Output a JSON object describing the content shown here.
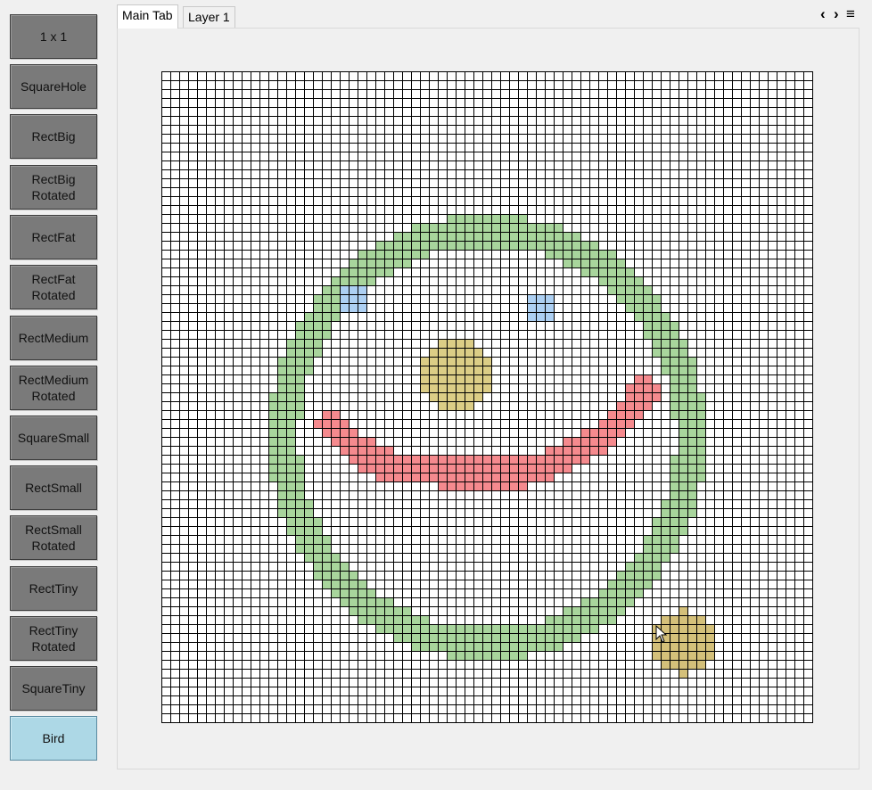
{
  "sidebar": {
    "buttons": [
      {
        "label": "1 x 1",
        "selected": false
      },
      {
        "label": "SquareHole",
        "selected": false
      },
      {
        "label": "RectBig",
        "selected": false
      },
      {
        "label": "RectBig\nRotated",
        "selected": false
      },
      {
        "label": "RectFat",
        "selected": false
      },
      {
        "label": "RectFat\nRotated",
        "selected": false
      },
      {
        "label": "RectMedium",
        "selected": false
      },
      {
        "label": "RectMedium\nRotated",
        "selected": false
      },
      {
        "label": "SquareSmall",
        "selected": false
      },
      {
        "label": "RectSmall",
        "selected": false
      },
      {
        "label": "RectSmall\nRotated",
        "selected": false
      },
      {
        "label": "RectTiny",
        "selected": false
      },
      {
        "label": "RectTiny\nRotated",
        "selected": false
      },
      {
        "label": "SquareTiny",
        "selected": false
      },
      {
        "label": "Bird",
        "selected": true
      }
    ]
  },
  "tabs": [
    {
      "label": "Main Tab",
      "active": true
    },
    {
      "label": "Layer 1",
      "active": false
    }
  ],
  "tab_nav": {
    "prev": "‹",
    "next": "›",
    "menu": "≡"
  },
  "canvas": {
    "columns": 73,
    "rows": 73,
    "background": "#ffffff",
    "grid_line_color": "#000000",
    "colors": {
      "face_outline": "#a8d59c",
      "eye": "#add0f3",
      "nose": "#dccd86",
      "mouth": "#f58a8e",
      "bird_cursor": "#d4c07a"
    }
  }
}
